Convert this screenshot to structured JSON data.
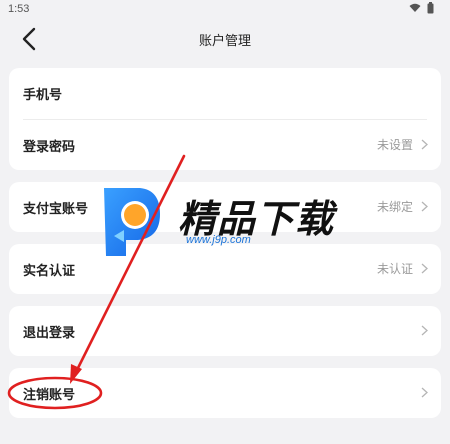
{
  "status_bar": {
    "time": "1:53"
  },
  "header": {
    "title": "账户管理"
  },
  "cards": [
    {
      "rows": [
        {
          "label": "手机号",
          "value": ""
        },
        {
          "label": "登录密码",
          "value": "未设置"
        }
      ]
    },
    {
      "rows": [
        {
          "label": "支付宝账号",
          "value": "未绑定"
        }
      ]
    },
    {
      "rows": [
        {
          "label": "实名认证",
          "value": "未认证"
        }
      ]
    },
    {
      "rows": [
        {
          "label": "退出登录",
          "value": ""
        }
      ]
    },
    {
      "rows": [
        {
          "label": "注销账号",
          "value": ""
        }
      ]
    }
  ],
  "watermark": {
    "brand": "精品下载",
    "url": "www.j9p.com"
  },
  "colors": {
    "accent_annotation": "#e02020",
    "card_bg": "#ffffff",
    "page_bg": "#f2f2f4"
  },
  "icons": {
    "back": "chevron-left-icon",
    "row_arrow": "chevron-right-icon",
    "wifi": "wifi-icon",
    "battery": "battery-icon"
  }
}
